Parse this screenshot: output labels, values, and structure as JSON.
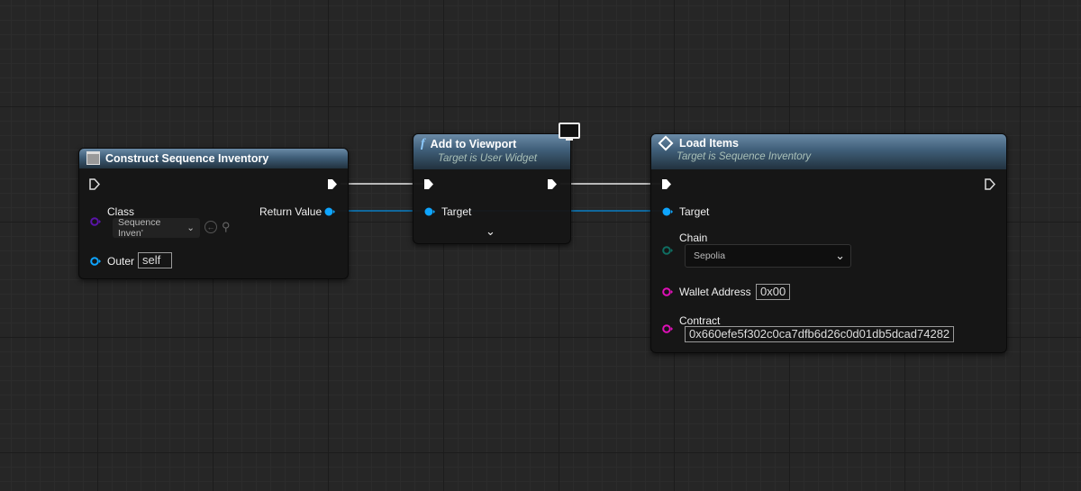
{
  "colors": {
    "exec": "#ffffff",
    "object_pin": "#0ea5ff",
    "class_pin": "#5a14a8",
    "enum_pin": "#0f6e62",
    "string_pin": "#e010b8",
    "header": "#3f5e78"
  },
  "node_construct": {
    "title": "Construct Sequence Inventory",
    "icon": "window-icon",
    "class_label": "Class",
    "class_value": "Sequence Inven’",
    "return_label": "Return Value",
    "outer_label": "Outer",
    "outer_value": "self"
  },
  "node_viewport": {
    "title": "Add to Viewport",
    "subtitle": "Target is User Widget",
    "icon": "function-icon",
    "badge_icon": "monitor-icon",
    "target_label": "Target"
  },
  "node_load": {
    "title": "Load Items",
    "subtitle": "Target is Sequence Inventory",
    "icon": "diamond-icon",
    "target_label": "Target",
    "chain_label": "Chain",
    "chain_value": "Sepolia",
    "wallet_label": "Wallet Address",
    "wallet_value": "0x00",
    "contract_label": "Contract",
    "contract_value": "0x660efe5f302c0ca7dfb6d26c0d01db5dcad74282"
  }
}
